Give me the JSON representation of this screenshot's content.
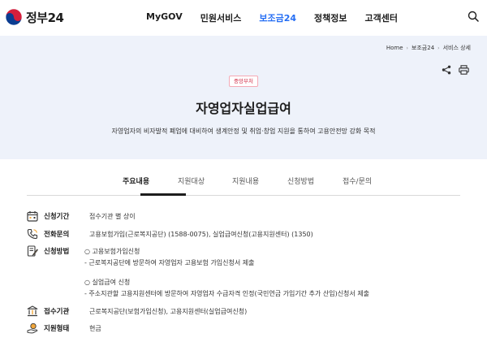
{
  "header": {
    "logo_text": "정부24",
    "nav": [
      "MyGOV",
      "민원서비스",
      "보조금24",
      "정책정보",
      "고객센터"
    ],
    "active_nav": 2,
    "brand_color": "#256ef4"
  },
  "breadcrumb": [
    "Home",
    "보조금24",
    "서비스 상세"
  ],
  "hero": {
    "badge": "중앙부처",
    "title": "자영업자실업급여",
    "description": "자영업자의 비자발적 폐업에 대비하여 생계안정 및 취업·창업 지원을 통하여 고용안전망 강화 목적"
  },
  "tabs": [
    "주요내용",
    "지원대상",
    "지원내용",
    "신청방법",
    "접수/문의"
  ],
  "info": {
    "period": {
      "label": "신청기간",
      "value": "접수기관 별 상이"
    },
    "phone": {
      "label": "전화문의",
      "value": "고용보험가입(근로복지공단) (1588-0075), 실업급여신청(고용지원센터) (1350)"
    },
    "method": {
      "label": "신청방법",
      "lines": [
        "○ 고용보험가입신청",
        "- 근로복지공단에 방문하여 자영업자 고용보험 가입신청서 제출",
        "○ 실업급여 신청",
        "- 주소지관할 고용지원센터에 방문하여 자영업자 수급자격 인정(국민연금 가입기간 추가 산입)신청서 제출"
      ]
    },
    "agency": {
      "label": "접수기관",
      "value": "근로복지공단(보험가입신청), 고용지원센터(실업급여신청)"
    },
    "support_type": {
      "label": "지원형태",
      "value": "현금"
    }
  }
}
